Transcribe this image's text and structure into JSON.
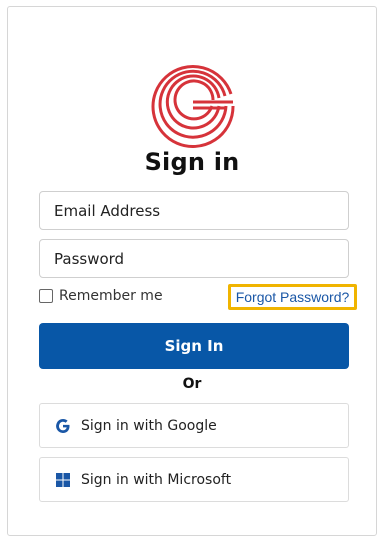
{
  "form": {
    "title": "Sign in",
    "email_placeholder": "Email Address",
    "password_placeholder": "Password",
    "remember_label": "Remember me",
    "remember_checked": false,
    "forgot_label": "Forgot Password?",
    "submit_label": "Sign In",
    "divider_label": "Or"
  },
  "sso": {
    "google_label": "Sign in with Google",
    "microsoft_label": "Sign in with Microsoft"
  },
  "icons": {
    "brand_logo": "g-rings-logo",
    "google": "google-g-icon",
    "microsoft": "windows-icon"
  },
  "colors": {
    "primary": "#0857a7",
    "link": "#1a57a6",
    "highlight": "#f0b400",
    "logo_red": "#d6333a"
  }
}
